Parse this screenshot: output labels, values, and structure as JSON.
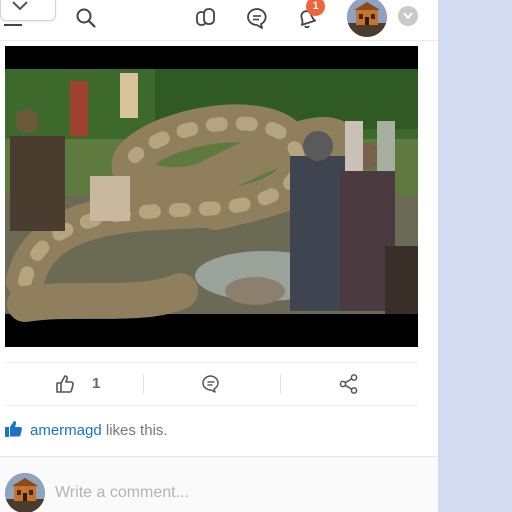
{
  "topbar": {
    "icons": [
      "chevron-down-icon",
      "menu-icon",
      "search-icon",
      "groups-icon",
      "chat-icon",
      "notifications-bell-icon",
      "chevron-down-icon"
    ],
    "notification_count": "1"
  },
  "post": {
    "image": "photo of a giant snake lying on a riverbank surrounded by a crowd of people",
    "actions": {
      "like_count": "1",
      "icons": [
        "thumbs-up-icon",
        "comment-icon",
        "share-icon"
      ]
    },
    "likes": {
      "user": "amermagd",
      "suffix": " likes this."
    }
  },
  "comment": {
    "placeholder": "Write a comment..."
  },
  "colors": {
    "link": "#1a73c8",
    "badge": "#f0643a",
    "side_panel": "#d3dbf0"
  }
}
